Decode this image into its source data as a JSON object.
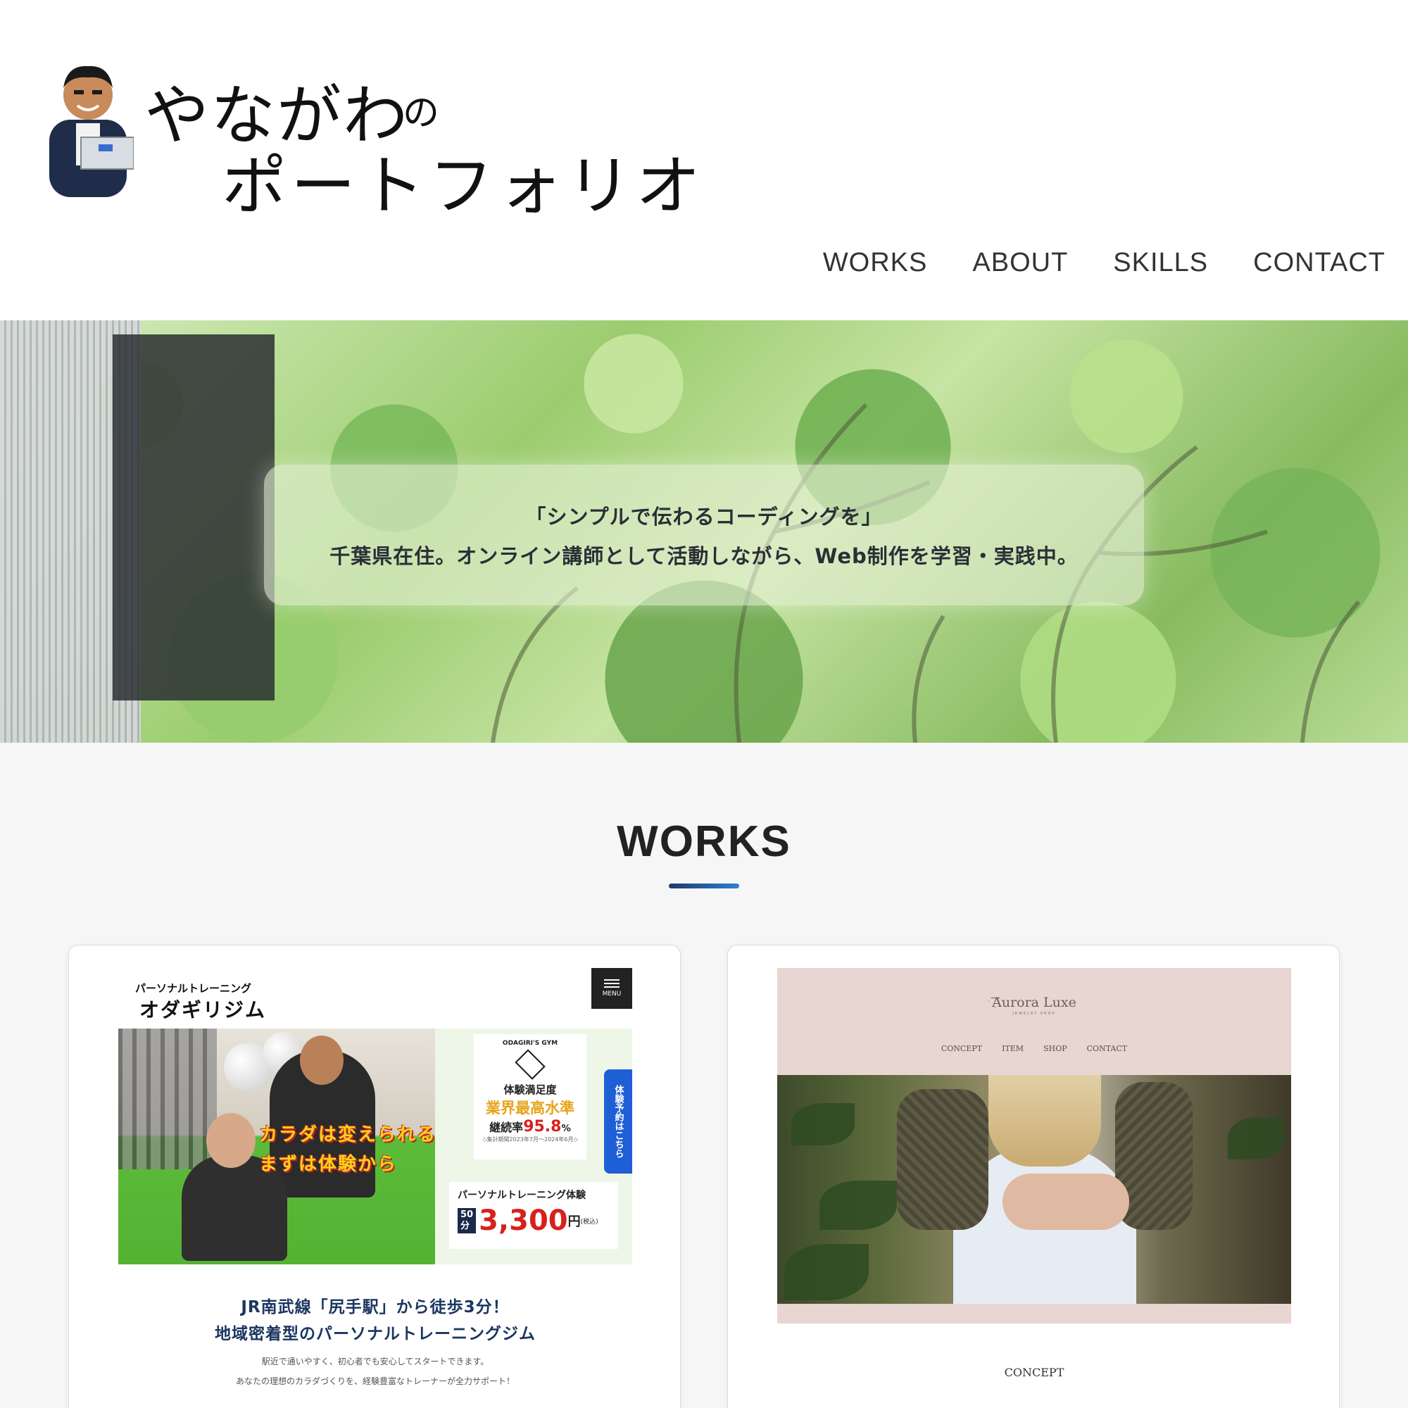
{
  "header": {
    "logo_line1": "やながわ",
    "logo_no": "の",
    "logo_line2": "ポートフォリオ",
    "nav": [
      "WORKS",
      "ABOUT",
      "SKILLS",
      "CONTACT"
    ]
  },
  "hero": {
    "line1": "「シンプルで伝わるコーディングを」",
    "line2": "千葉県在住。オンライン講師として活動しながら、Web制作を学習・実践中。"
  },
  "works": {
    "title": "WORKS",
    "gym": {
      "brand_small": "パーソナルトレーニング",
      "brand": "オダギリジム",
      "menu": "MENU",
      "overlay1": "カラダは変えられる！",
      "overlay2": "まずは体験から",
      "gym_name": "ODAGIRI'S GYM",
      "satisfaction": "体験満足度",
      "top_level": "業界最高水準",
      "retention_label": "継続率",
      "retention_value": "95.8",
      "retention_unit": "%",
      "period": "◇集計期間2023年7月～2024年6月◇",
      "reserve": "体験予約はこちら",
      "price_label": "パーソナルトレーニング体験",
      "price_minutes": "50",
      "price_minutes_unit": "分",
      "price_amount": "3,300",
      "price_yen": "円",
      "price_tax": "(税込)",
      "sub1": "JR南武線「尻手駅」から徒歩3分！",
      "sub2": "地域密着型のパーソナルトレーニングジム",
      "desc1": "駅近で通いやすく、初心者でも安心してスタートできます。",
      "desc2": "あなたの理想のカラダづくりを、経験豊富なトレーナーが全力サポート！"
    },
    "jewelry": {
      "logo": "Aurora Luxe",
      "logo_sub": "JEWELRY SHOP",
      "nav": [
        "CONCEPT",
        "ITEM",
        "SHOP",
        "CONTACT"
      ],
      "concept": "CONCEPT"
    }
  },
  "colors": {
    "accent_start": "#1c3c66",
    "accent_end": "#2d7fd6",
    "gym_navy": "#1b3660",
    "gym_red": "#d8201c",
    "jewelry_bg": "#e8d6d2"
  }
}
